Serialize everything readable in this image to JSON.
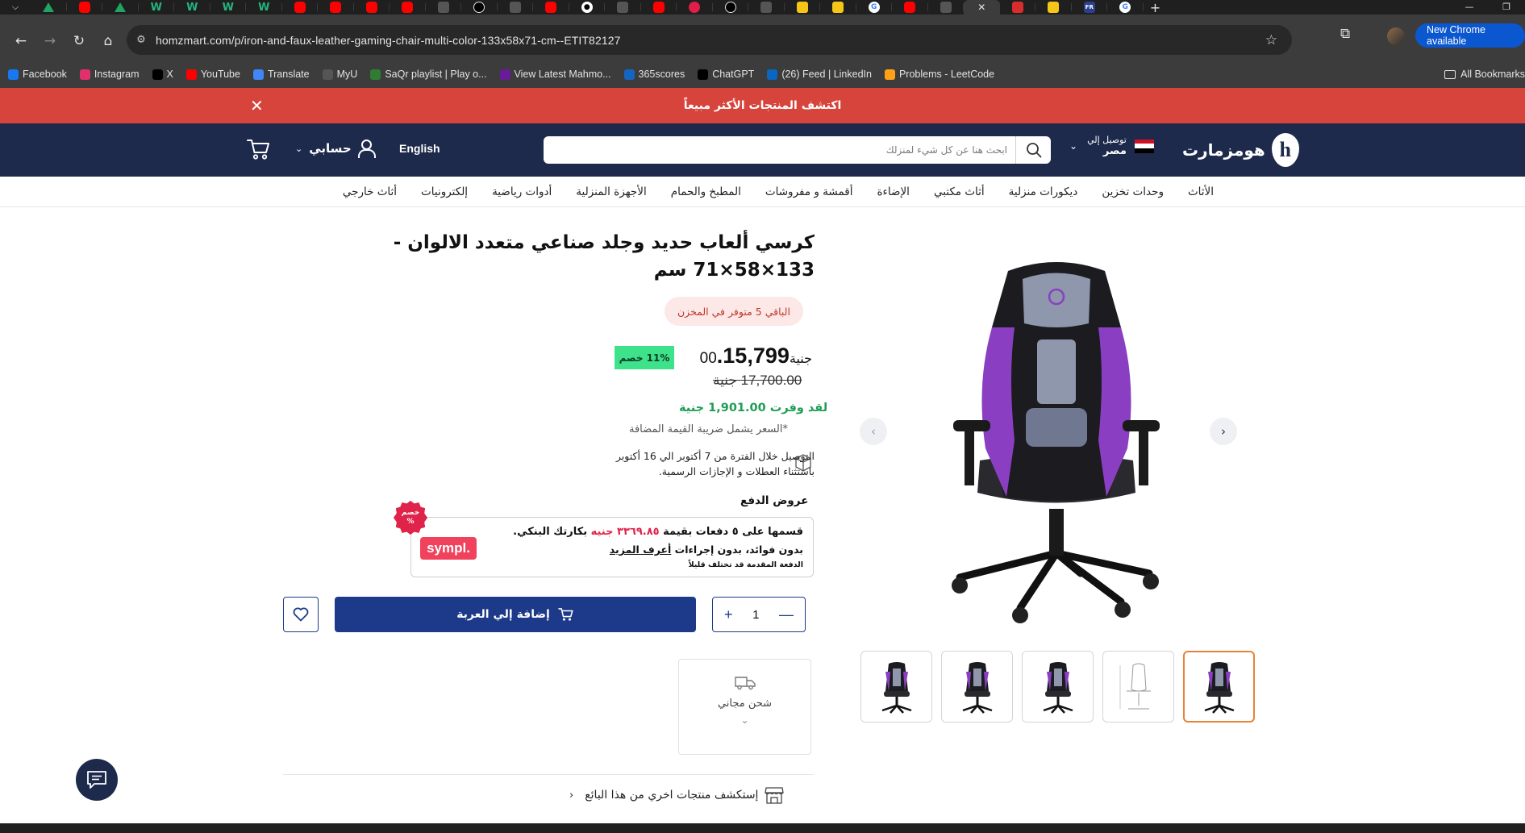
{
  "browser": {
    "url": "homzmart.com/p/iron-and-faux-leather-gaming-chair-multi-color-133x58x71-cm--ETIT82127",
    "new_chrome_label": "New Chrome available",
    "tabs": [
      {
        "icon": "google-drive-icon"
      },
      {
        "icon": "youtube-icon"
      },
      {
        "icon": "google-drive-icon"
      },
      {
        "icon": "w-icon"
      },
      {
        "icon": "w-icon"
      },
      {
        "icon": "w-icon"
      },
      {
        "icon": "w-icon"
      },
      {
        "icon": "youtube-icon"
      },
      {
        "icon": "youtube-icon"
      },
      {
        "icon": "youtube-icon"
      },
      {
        "icon": "youtube-icon"
      },
      {
        "icon": "avatar-icon"
      },
      {
        "icon": "chatgpt-icon"
      },
      {
        "icon": "green-icon"
      },
      {
        "icon": "youtube-icon"
      },
      {
        "icon": "github-icon"
      },
      {
        "icon": "id-icon"
      },
      {
        "icon": "youtube-icon"
      },
      {
        "icon": "pink-icon"
      },
      {
        "icon": "chatgpt-icon"
      },
      {
        "icon": "generic-icon"
      },
      {
        "icon": "yellow-icon"
      },
      {
        "icon": "yellow-icon"
      },
      {
        "icon": "google-icon"
      },
      {
        "icon": "youtube-icon"
      },
      {
        "icon": "green-circle-icon"
      },
      {
        "icon": "google-icon"
      },
      {
        "icon": "x-icon"
      },
      {
        "icon": "google-drive-icon"
      },
      {
        "icon": "translate-icon"
      },
      {
        "icon": "chatgpt-icon"
      },
      {
        "icon": "react-icon"
      },
      {
        "icon": "alert-icon"
      },
      {
        "icon": "homzmart-icon"
      },
      {
        "icon": "dark-icon"
      },
      {
        "icon": "yellow-icon"
      },
      {
        "icon": "fr-icon"
      },
      {
        "icon": "google-icon"
      }
    ],
    "bookmarks": [
      {
        "label": "Facebook",
        "icon": "facebook-icon",
        "color": "#1877f2"
      },
      {
        "label": "Instagram",
        "icon": "instagram-icon",
        "color": "#e1306c"
      },
      {
        "label": "X",
        "icon": "x-icon",
        "color": "#000000"
      },
      {
        "label": "YouTube",
        "icon": "youtube-icon",
        "color": "#ff0000"
      },
      {
        "label": "Translate",
        "icon": "translate-icon",
        "color": "#4285f4"
      },
      {
        "label": "MyU",
        "icon": "myu-icon",
        "color": "#555555"
      },
      {
        "label": "SaQr playlist | Play o...",
        "icon": "saqr-icon",
        "color": "#2e7d32"
      },
      {
        "label": "View Latest Mahmo...",
        "icon": "purple-icon",
        "color": "#6a1b9a"
      },
      {
        "label": "365scores",
        "icon": "365-icon",
        "color": "#1565c0"
      },
      {
        "label": "ChatGPT",
        "icon": "chatgpt-icon",
        "color": "#000000"
      },
      {
        "label": "(26) Feed | LinkedIn",
        "icon": "linkedin-icon",
        "color": "#0a66c2"
      },
      {
        "label": "Problems - LeetCode",
        "icon": "leetcode-icon",
        "color": "#ffa116"
      }
    ],
    "all_bookmarks_label": "All Bookmarks"
  },
  "site": {
    "promo_text": "اكتشف المنتجات الأكثر مبيعاً",
    "logo_text": "هومزمارت",
    "logo_letter": "h",
    "deliver_label": "توصيل إلي",
    "deliver_country": "مصر",
    "search_placeholder": "ابحث هنا عن كل شيء لمنزلك",
    "language": "English",
    "account_label": "حسابي",
    "categories": [
      "الأثاث",
      "وحدات تخزين",
      "ديكورات منزلية",
      "أثاث مكتبي",
      "الإضاءة",
      "أقمشة و مفروشات",
      "المطبخ والحمام",
      "الأجهزة المنزلية",
      "أدوات رياضية",
      "إلكترونيات",
      "أثاث خارجي"
    ]
  },
  "product": {
    "title": "كرسي ألعاب حديد وجلد صناعي متعدد الالوان - 133×58×71 سم",
    "stock_text": "الباقي 5 متوفر في المخزن",
    "price_main": "15,799.",
    "price_decimal": "00",
    "currency": "جنية",
    "discount_badge": "11% خصم",
    "old_price": "17,700.00 جنية",
    "saved_text": "لقد وفرت 1,901.00 جنية",
    "vat_note": "*السعر يشمل ضريبة القيمة المضافة",
    "delivery_line1": "التوصيل خلال الفترة من 7 أكتوبر الي 16 أكتوبر",
    "delivery_line2": "باستثناء العطلات و الإجازات الرسمية.",
    "payment_offers_title": "عروض الدفع",
    "sympl_line1_a": "قسمها على ٥ دفعات بقيمة ",
    "sympl_line1_amount": "٣٣٦٩.٨٥ جنيه",
    "sympl_line1_b": " بكارتك البنكي.",
    "sympl_line2_a": "بدون فوائد، بدون إجراءات ",
    "sympl_line2_link": "أعرف المزيد",
    "sympl_line3": "الدفعة المقدمة قد تختلف قليلاً",
    "sympl_logo": "sympl.",
    "sympl_badge_1": "خصم",
    "sympl_badge_2": "%",
    "quantity": "1",
    "add_to_cart": "إضافة إلي العربة",
    "free_shipping": "شحن مجاني",
    "explore_seller": "إستكشف منتجات اخري من هذا البائع",
    "thumbnails": 5,
    "active_thumbnail": 1
  },
  "colors": {
    "navy": "#1d2a4b",
    "button_blue": "#1d3a8a",
    "promo_red": "#d6443b",
    "discount_green": "#3ee28a",
    "saved_green": "#1f9d55",
    "active_thumb": "#e8823a"
  }
}
